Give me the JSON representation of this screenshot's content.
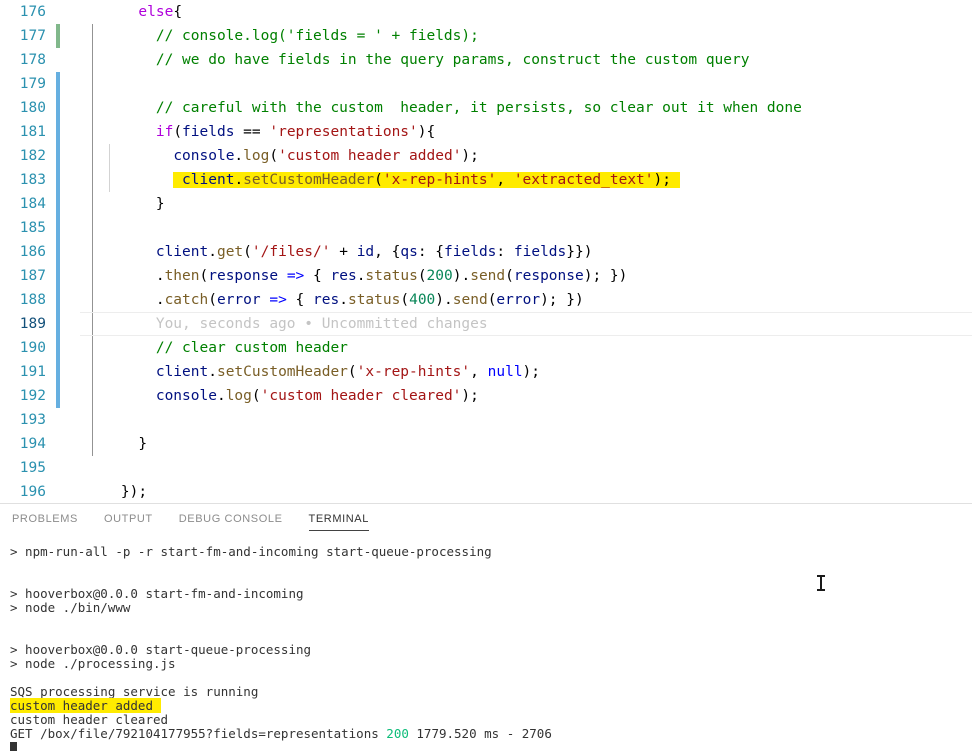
{
  "editor": {
    "first_line_number": 176,
    "active_line_number": 189,
    "blame_text": "You, seconds ago • Uncommitted changes",
    "lines": [
      {
        "num": 176,
        "marker": "none",
        "indent_guides": 0,
        "tokens": [
          {
            "t": "      ",
            "c": "plain"
          },
          {
            "t": "else",
            "c": "kw"
          },
          {
            "t": "{",
            "c": "plain"
          }
        ]
      },
      {
        "num": 177,
        "marker": "added",
        "indent_guides": 1,
        "tokens": [
          {
            "t": "        ",
            "c": "plain"
          },
          {
            "t": "// console.log('fields = ' + fields);",
            "c": "comment"
          }
        ]
      },
      {
        "num": 178,
        "marker": "none",
        "indent_guides": 1,
        "tokens": [
          {
            "t": "        ",
            "c": "plain"
          },
          {
            "t": "// we do have fields in the query params, construct the custom query",
            "c": "comment"
          }
        ]
      },
      {
        "num": 179,
        "marker": "modified",
        "indent_guides": 1,
        "tokens": []
      },
      {
        "num": 180,
        "marker": "modified",
        "indent_guides": 1,
        "tokens": [
          {
            "t": "        ",
            "c": "plain"
          },
          {
            "t": "// careful with the custom  header, it persists, so clear out it when done",
            "c": "comment"
          }
        ]
      },
      {
        "num": 181,
        "marker": "modified",
        "indent_guides": 1,
        "tokens": [
          {
            "t": "        ",
            "c": "plain"
          },
          {
            "t": "if",
            "c": "kw"
          },
          {
            "t": "(",
            "c": "plain"
          },
          {
            "t": "fields",
            "c": "var"
          },
          {
            "t": " == ",
            "c": "plain"
          },
          {
            "t": "'representations'",
            "c": "string"
          },
          {
            "t": "){",
            "c": "plain"
          }
        ]
      },
      {
        "num": 182,
        "marker": "modified",
        "indent_guides": 2,
        "tokens": [
          {
            "t": "          ",
            "c": "plain"
          },
          {
            "t": "console",
            "c": "var"
          },
          {
            "t": ".",
            "c": "plain"
          },
          {
            "t": "log",
            "c": "fn"
          },
          {
            "t": "(",
            "c": "plain"
          },
          {
            "t": "'custom header added'",
            "c": "string"
          },
          {
            "t": ");",
            "c": "plain"
          }
        ]
      },
      {
        "num": 183,
        "marker": "modified",
        "indent_guides": 2,
        "highlight": true,
        "tokens": [
          {
            "t": "          ",
            "c": "plain"
          },
          {
            "t": "client",
            "c": "var"
          },
          {
            "t": ".",
            "c": "plain"
          },
          {
            "t": "setCustomHeader",
            "c": "fn"
          },
          {
            "t": "(",
            "c": "plain"
          },
          {
            "t": "'x-rep-hints'",
            "c": "string"
          },
          {
            "t": ", ",
            "c": "plain"
          },
          {
            "t": "'extracted_text'",
            "c": "string"
          },
          {
            "t": ");",
            "c": "plain"
          }
        ]
      },
      {
        "num": 184,
        "marker": "modified",
        "indent_guides": 1,
        "tokens": [
          {
            "t": "        }",
            "c": "plain"
          }
        ]
      },
      {
        "num": 185,
        "marker": "modified",
        "indent_guides": 1,
        "tokens": []
      },
      {
        "num": 186,
        "marker": "modified",
        "indent_guides": 1,
        "tokens": [
          {
            "t": "        ",
            "c": "plain"
          },
          {
            "t": "client",
            "c": "var"
          },
          {
            "t": ".",
            "c": "plain"
          },
          {
            "t": "get",
            "c": "fn"
          },
          {
            "t": "(",
            "c": "plain"
          },
          {
            "t": "'/files/'",
            "c": "string"
          },
          {
            "t": " + ",
            "c": "plain"
          },
          {
            "t": "id",
            "c": "var"
          },
          {
            "t": ", {",
            "c": "plain"
          },
          {
            "t": "qs",
            "c": "var"
          },
          {
            "t": ": {",
            "c": "plain"
          },
          {
            "t": "fields",
            "c": "var"
          },
          {
            "t": ": ",
            "c": "plain"
          },
          {
            "t": "fields",
            "c": "var"
          },
          {
            "t": "}})",
            "c": "plain"
          }
        ]
      },
      {
        "num": 187,
        "marker": "modified",
        "indent_guides": 1,
        "tokens": [
          {
            "t": "        .",
            "c": "plain"
          },
          {
            "t": "then",
            "c": "fn"
          },
          {
            "t": "(",
            "c": "plain"
          },
          {
            "t": "response",
            "c": "var"
          },
          {
            "t": " ",
            "c": "plain"
          },
          {
            "t": "=>",
            "c": "op"
          },
          {
            "t": " { ",
            "c": "plain"
          },
          {
            "t": "res",
            "c": "var"
          },
          {
            "t": ".",
            "c": "plain"
          },
          {
            "t": "status",
            "c": "fn"
          },
          {
            "t": "(",
            "c": "plain"
          },
          {
            "t": "200",
            "c": "num"
          },
          {
            "t": ").",
            "c": "plain"
          },
          {
            "t": "send",
            "c": "fn"
          },
          {
            "t": "(",
            "c": "plain"
          },
          {
            "t": "response",
            "c": "var"
          },
          {
            "t": "); })",
            "c": "plain"
          }
        ]
      },
      {
        "num": 188,
        "marker": "modified",
        "indent_guides": 1,
        "tokens": [
          {
            "t": "        .",
            "c": "plain"
          },
          {
            "t": "catch",
            "c": "fn"
          },
          {
            "t": "(",
            "c": "plain"
          },
          {
            "t": "error",
            "c": "var"
          },
          {
            "t": " ",
            "c": "plain"
          },
          {
            "t": "=>",
            "c": "op"
          },
          {
            "t": " { ",
            "c": "plain"
          },
          {
            "t": "res",
            "c": "var"
          },
          {
            "t": ".",
            "c": "plain"
          },
          {
            "t": "status",
            "c": "fn"
          },
          {
            "t": "(",
            "c": "plain"
          },
          {
            "t": "400",
            "c": "num"
          },
          {
            "t": ").",
            "c": "plain"
          },
          {
            "t": "send",
            "c": "fn"
          },
          {
            "t": "(",
            "c": "plain"
          },
          {
            "t": "error",
            "c": "var"
          },
          {
            "t": "); })",
            "c": "plain"
          }
        ]
      },
      {
        "num": 189,
        "marker": "modified",
        "indent_guides": 1,
        "active": true,
        "blame": true,
        "tokens": []
      },
      {
        "num": 190,
        "marker": "modified",
        "indent_guides": 1,
        "tokens": [
          {
            "t": "        ",
            "c": "plain"
          },
          {
            "t": "// clear custom header",
            "c": "comment"
          }
        ]
      },
      {
        "num": 191,
        "marker": "modified",
        "indent_guides": 1,
        "tokens": [
          {
            "t": "        ",
            "c": "plain"
          },
          {
            "t": "client",
            "c": "var"
          },
          {
            "t": ".",
            "c": "plain"
          },
          {
            "t": "setCustomHeader",
            "c": "fn"
          },
          {
            "t": "(",
            "c": "plain"
          },
          {
            "t": "'x-rep-hints'",
            "c": "string"
          },
          {
            "t": ", ",
            "c": "plain"
          },
          {
            "t": "null",
            "c": "kw2"
          },
          {
            "t": ");",
            "c": "plain"
          }
        ]
      },
      {
        "num": 192,
        "marker": "modified",
        "indent_guides": 1,
        "tokens": [
          {
            "t": "        ",
            "c": "plain"
          },
          {
            "t": "console",
            "c": "var"
          },
          {
            "t": ".",
            "c": "plain"
          },
          {
            "t": "log",
            "c": "fn"
          },
          {
            "t": "(",
            "c": "plain"
          },
          {
            "t": "'custom header cleared'",
            "c": "string"
          },
          {
            "t": ");",
            "c": "plain"
          }
        ]
      },
      {
        "num": 193,
        "marker": "none",
        "indent_guides": 1,
        "tokens": []
      },
      {
        "num": 194,
        "marker": "none",
        "indent_guides": 1,
        "tokens": [
          {
            "t": "      }",
            "c": "plain"
          }
        ]
      },
      {
        "num": 195,
        "marker": "none",
        "indent_guides": 0,
        "tokens": []
      },
      {
        "num": 196,
        "marker": "none",
        "indent_guides": 0,
        "tokens": [
          {
            "t": "    });",
            "c": "plain"
          }
        ]
      }
    ]
  },
  "panel": {
    "tabs": [
      {
        "label": "PROBLEMS",
        "active": false
      },
      {
        "label": "OUTPUT",
        "active": false
      },
      {
        "label": "DEBUG CONSOLE",
        "active": false
      },
      {
        "label": "TERMINAL",
        "active": true
      }
    ],
    "terminal_lines": [
      {
        "text": "> npm-run-all -p -r start-fm-and-incoming start-queue-processing"
      },
      {
        "text": ""
      },
      {
        "text": ""
      },
      {
        "text": "> hooverbox@0.0.0 start-fm-and-incoming"
      },
      {
        "text": "> node ./bin/www"
      },
      {
        "text": ""
      },
      {
        "text": ""
      },
      {
        "text": "> hooverbox@0.0.0 start-queue-processing"
      },
      {
        "text": "> node ./processing.js"
      },
      {
        "text": ""
      },
      {
        "text": "SQS processing service is running"
      },
      {
        "text": "custom header added ",
        "highlight": true
      },
      {
        "text": "custom header cleared"
      },
      {
        "segments": [
          {
            "t": "GET /box/file/792104177955?fields=representations ",
            "c": "plain"
          },
          {
            "t": "200",
            "c": "green"
          },
          {
            "t": " 1779.520 ms - 2706",
            "c": "plain"
          }
        ]
      },
      {
        "cursor": true
      }
    ]
  },
  "colors": {
    "highlight_yellow": "#ffeb00",
    "gutter_added": "#81b88b",
    "gutter_modified": "#66afe0",
    "line_number": "#2b91af",
    "status_ok_green": "#0dbc79"
  }
}
